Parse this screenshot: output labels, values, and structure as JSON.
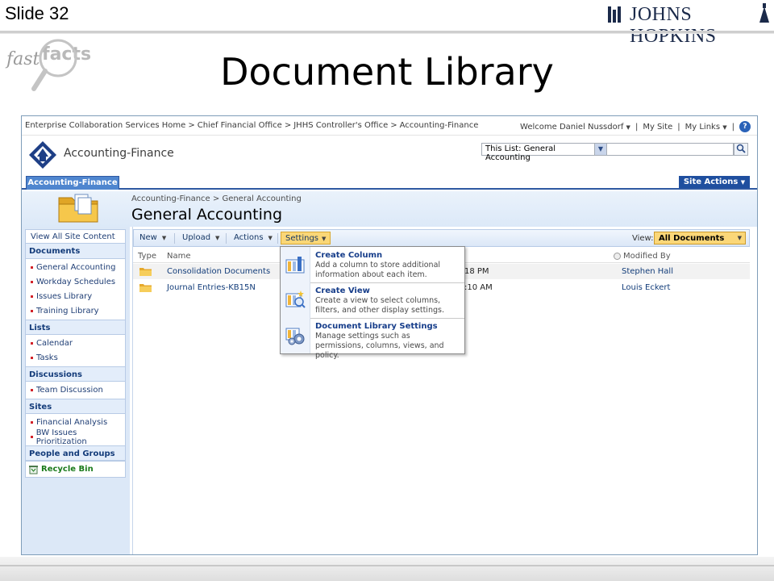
{
  "slide": {
    "number_label": "Slide 32",
    "title": "Document Library",
    "logo_text": "JOHNS HOPKINS",
    "fastfacts_logo": "fast facts"
  },
  "topbar": {
    "breadcrumb": [
      "Enterprise Collaboration Services Home",
      "Chief Financial Office",
      "JHHS Controller's Office",
      "Accounting-Finance"
    ],
    "separator": ">",
    "welcome": "Welcome Daniel Nussdorf",
    "my_site": "My Site",
    "my_links": "My Links",
    "divider": "|",
    "help_glyph": "?"
  },
  "site": {
    "title": "Accounting-Finance",
    "search_scope": "This List: General Accounting",
    "search_value": ""
  },
  "tabs": {
    "active": "Accounting-Finance",
    "site_actions": "Site Actions"
  },
  "page": {
    "breadcrumb": "Accounting-Finance > General Accounting",
    "title": "General Accounting"
  },
  "leftnav": {
    "view_all": "View All Site Content",
    "sections": {
      "documents": "Documents",
      "lists": "Lists",
      "discussions": "Discussions",
      "sites": "Sites",
      "people": "People and Groups"
    },
    "documents_items": [
      "General Accounting",
      "Workday Schedules",
      "Issues Library",
      "Training Library"
    ],
    "lists_items": [
      "Calendar",
      "Tasks"
    ],
    "discussions_items": [
      "Team Discussion"
    ],
    "sites_items": [
      "Financial Analysis",
      "BW Issues Prioritization"
    ],
    "recycle_bin": "Recycle Bin"
  },
  "toolbar": {
    "new": "New",
    "upload": "Upload",
    "actions": "Actions",
    "settings": "Settings",
    "view_label": "View:",
    "view_value": "All Documents",
    "caret": "▼"
  },
  "columns": {
    "type": "Type",
    "name": "Name",
    "modified_by": "Modified By"
  },
  "rows": [
    {
      "name": "Consolidation Documents",
      "time": "18 PM",
      "modified_by": "Stephen Hall"
    },
    {
      "name": "Journal Entries-KB15N",
      "time": ":10 AM",
      "modified_by": "Louis Eckert"
    }
  ],
  "menu": {
    "items": [
      {
        "title": "Create Column",
        "desc": "Add a column to store additional information about each item."
      },
      {
        "title": "Create View",
        "desc": "Create a view to select columns, filters, and other display settings."
      },
      {
        "title": "Document Library Settings",
        "desc": "Manage settings such as permissions, columns, views, and policy."
      }
    ]
  },
  "colors": {
    "accent_blue": "#2f59a2",
    "settings_highlight": "#fad777",
    "link_blue": "#133d7a",
    "recycle_green": "#1a7a1a"
  }
}
